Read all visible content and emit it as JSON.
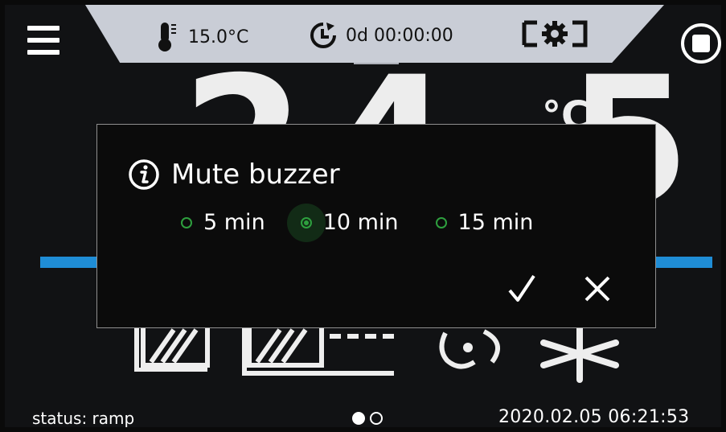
{
  "header": {
    "temperature": "15.0°C",
    "timer": "0d 00:00:00"
  },
  "display": {
    "big_value": "24.5",
    "unit": "°C"
  },
  "dialog": {
    "title": "Mute buzzer",
    "options": [
      {
        "label": "5 min",
        "selected": false
      },
      {
        "label": "10 min",
        "selected": true
      },
      {
        "label": "15 min",
        "selected": false
      }
    ],
    "confirm_icon": "check-icon",
    "cancel_icon": "close-icon"
  },
  "footer": {
    "status": "status: ramp",
    "datetime": "2020.02.05 06:21:53"
  },
  "colors": {
    "accent_green": "#2e9f3e",
    "bar_blue": "#1f8dd6",
    "topbar_grey": "#c9cdd6"
  }
}
